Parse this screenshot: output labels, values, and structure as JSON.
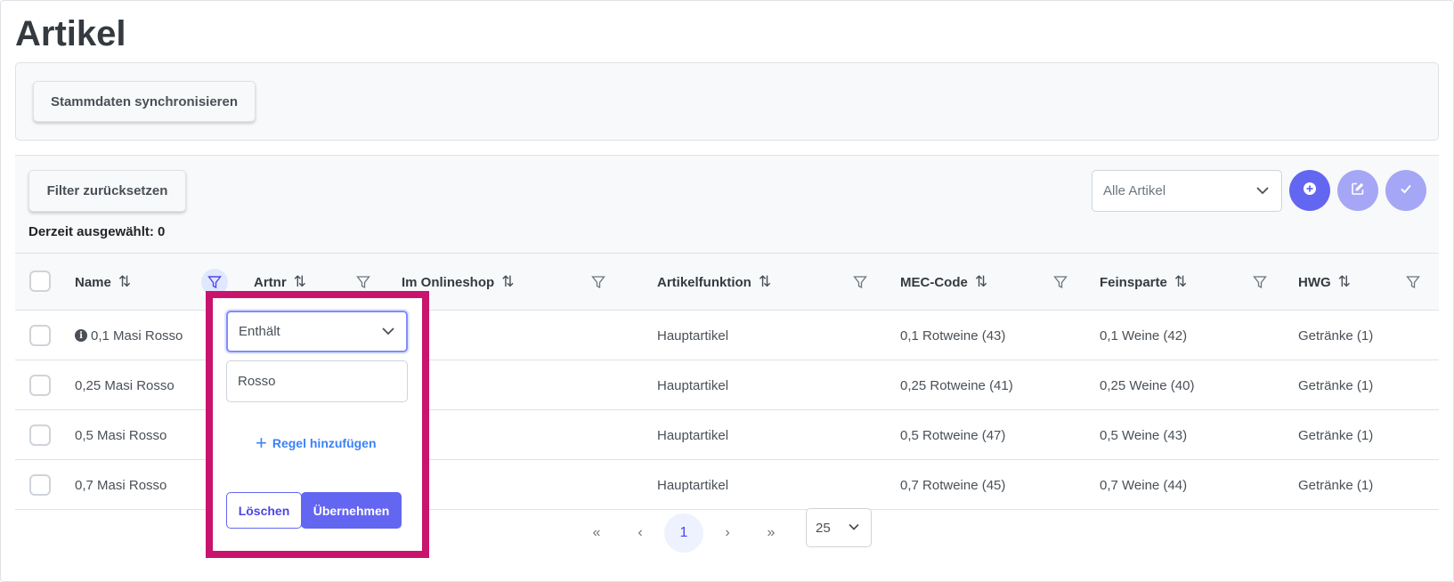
{
  "page": {
    "title": "Artikel"
  },
  "top_panel": {
    "sync_button": "Stammdaten synchronisieren"
  },
  "toolbar": {
    "reset_filter_button": "Filter zurücksetzen",
    "selected_text": "Derzeit ausgewählt: 0",
    "view_select": {
      "value": "Alle Artikel"
    },
    "action_icons": [
      "plus-circle-icon",
      "edit-icon",
      "check-icon"
    ],
    "accent_color": "#6366f1",
    "accent_light_color": "#a5a6f6"
  },
  "columns": [
    {
      "label": "Name"
    },
    {
      "label": "Artnr"
    },
    {
      "label": "Im Onlineshop"
    },
    {
      "label": "Artikelfunktion"
    },
    {
      "label": "MEC-Code"
    },
    {
      "label": "Feinsparte"
    },
    {
      "label": "HWG"
    }
  ],
  "sort_glyph": "⇅",
  "rows": [
    {
      "name": "0,1 Masi Rosso",
      "artnr": "",
      "onlineshop": "",
      "artikelfunktion": "Hauptartikel",
      "mec": "0,1 Rotweine (43)",
      "feinsparte": "0,1 Weine (42)",
      "hwg": "Getränke (1)"
    },
    {
      "name": "0,25 Masi Rosso",
      "artnr": "",
      "onlineshop": "",
      "artikelfunktion": "Hauptartikel",
      "mec": "0,25 Rotweine (41)",
      "feinsparte": "0,25 Weine (40)",
      "hwg": "Getränke (1)"
    },
    {
      "name": "0,5 Masi Rosso",
      "artnr": "",
      "onlineshop": "",
      "artikelfunktion": "Hauptartikel",
      "mec": "0,5 Rotweine (47)",
      "feinsparte": "0,5 Weine (43)",
      "hwg": "Getränke (1)"
    },
    {
      "name": "0,7 Masi Rosso",
      "artnr": "",
      "onlineshop": "",
      "artikelfunktion": "Hauptartikel",
      "mec": "0,7 Rotweine (45)",
      "feinsparte": "0,7 Weine (44)",
      "hwg": "Getränke (1)"
    }
  ],
  "pagination": {
    "first": "«",
    "prev": "‹",
    "current_page": "1",
    "next": "›",
    "last": "»",
    "rows_per_page": "25"
  },
  "filter_popup": {
    "match_mode": "Enthält",
    "value": "Rosso",
    "add_rule": "Regel hinzufügen",
    "clear_button": "Löschen",
    "apply_button": "Übernehmen",
    "highlight_color": "#c8146c"
  }
}
